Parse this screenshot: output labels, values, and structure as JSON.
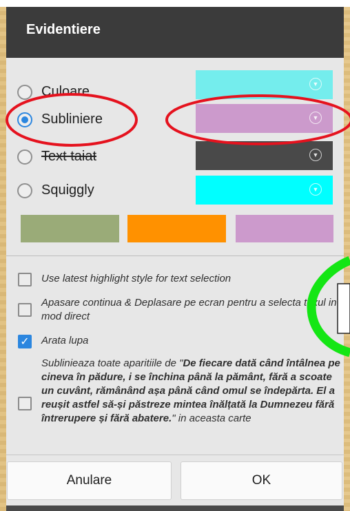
{
  "dialog": {
    "title": "Evidentiere",
    "styles": [
      {
        "label": "Culoare",
        "selected": false,
        "swatch_color": "#74eded"
      },
      {
        "label": "Subliniere",
        "selected": true,
        "swatch_color": "#cc9acc"
      },
      {
        "label": "Text taiat",
        "selected": false,
        "swatch_color": "#494949"
      },
      {
        "label": "Squiggly",
        "selected": false,
        "swatch_color": "#00ffff"
      }
    ],
    "presets": [
      "#9aab78",
      "#ff9100",
      "#cc9acc"
    ],
    "options": [
      {
        "label": "Use latest highlight style for text selection",
        "checked": false
      },
      {
        "label": "Apasare continua & Deplasare pe ecran pentru a selecta texul in mod direct",
        "checked": false
      },
      {
        "label": "Arata lupa",
        "checked": true
      }
    ],
    "highlight_all": {
      "prefix": "Sublinieaza toate aparitiile de \"",
      "quote": "De fiecare dată când întâlnea pe cineva în pădure, i se închina până la pământ, fără a scoate un cuvânt, rămânând așa până când omul se îndepărta. El a reușit astfel să-și păstreze mintea înălțată la Dumnezeu fără întrerupere și fără abatere.",
      "suffix": "\" in aceasta carte",
      "checked": false
    },
    "buttons": {
      "cancel": "Anulare",
      "ok": "OK"
    }
  },
  "annotations": {
    "red_ellipse_color": "#e5121e",
    "green_ring_color": "#14e614"
  }
}
